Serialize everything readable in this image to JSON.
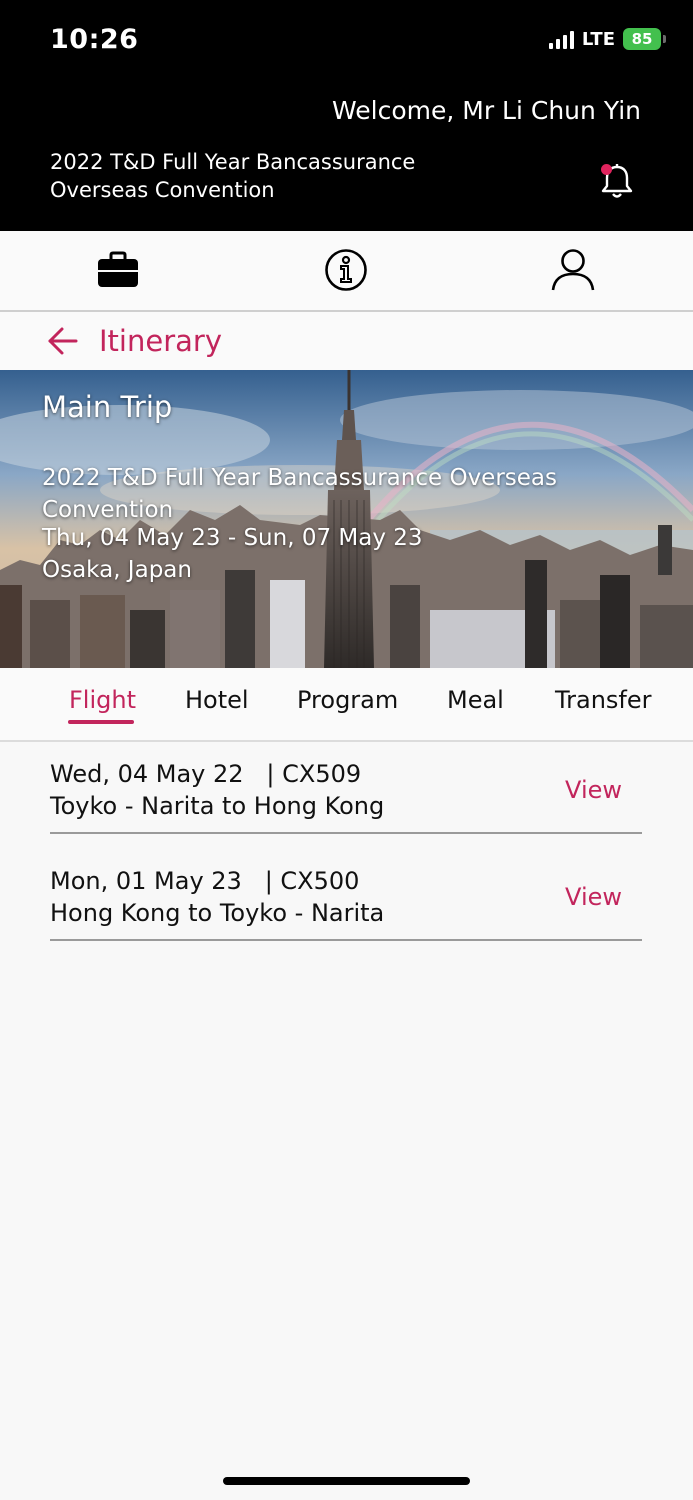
{
  "status": {
    "time": "10:26",
    "network": "LTE",
    "battery": "85"
  },
  "header": {
    "welcome": "Welcome, Mr Li Chun Yin",
    "event_line1": "2022 T&D Full Year Bancassurance",
    "event_line2": "Overseas Convention"
  },
  "icons": {
    "notification": "bell-icon",
    "nav": [
      "briefcase-icon",
      "info-icon",
      "user-icon"
    ],
    "back": "back-arrow-icon"
  },
  "page": {
    "title": "Itinerary"
  },
  "hero": {
    "label": "Main Trip",
    "conv_line1": "2022 T&D Full Year Bancassurance Overseas",
    "conv_line2": "Convention",
    "dates": "Thu, 04 May 23 - Sun, 07 May 23",
    "location": "Osaka, Japan"
  },
  "tabs": [
    "Flight",
    "Hotel",
    "Program",
    "Meal",
    "Transfer"
  ],
  "active_tab": "Flight",
  "flights": [
    {
      "date": "Wed, 04 May 22",
      "flight_no": "CX509",
      "route": "Toyko - Narita to Hong Kong",
      "action": "View"
    },
    {
      "date": "Mon, 01 May 23",
      "flight_no": "CX500",
      "route": "Hong Kong to Toyko - Narita",
      "action": "View"
    }
  ],
  "colors": {
    "accent": "#c2255c",
    "header_bg": "#000000",
    "battery": "#43c04e"
  }
}
